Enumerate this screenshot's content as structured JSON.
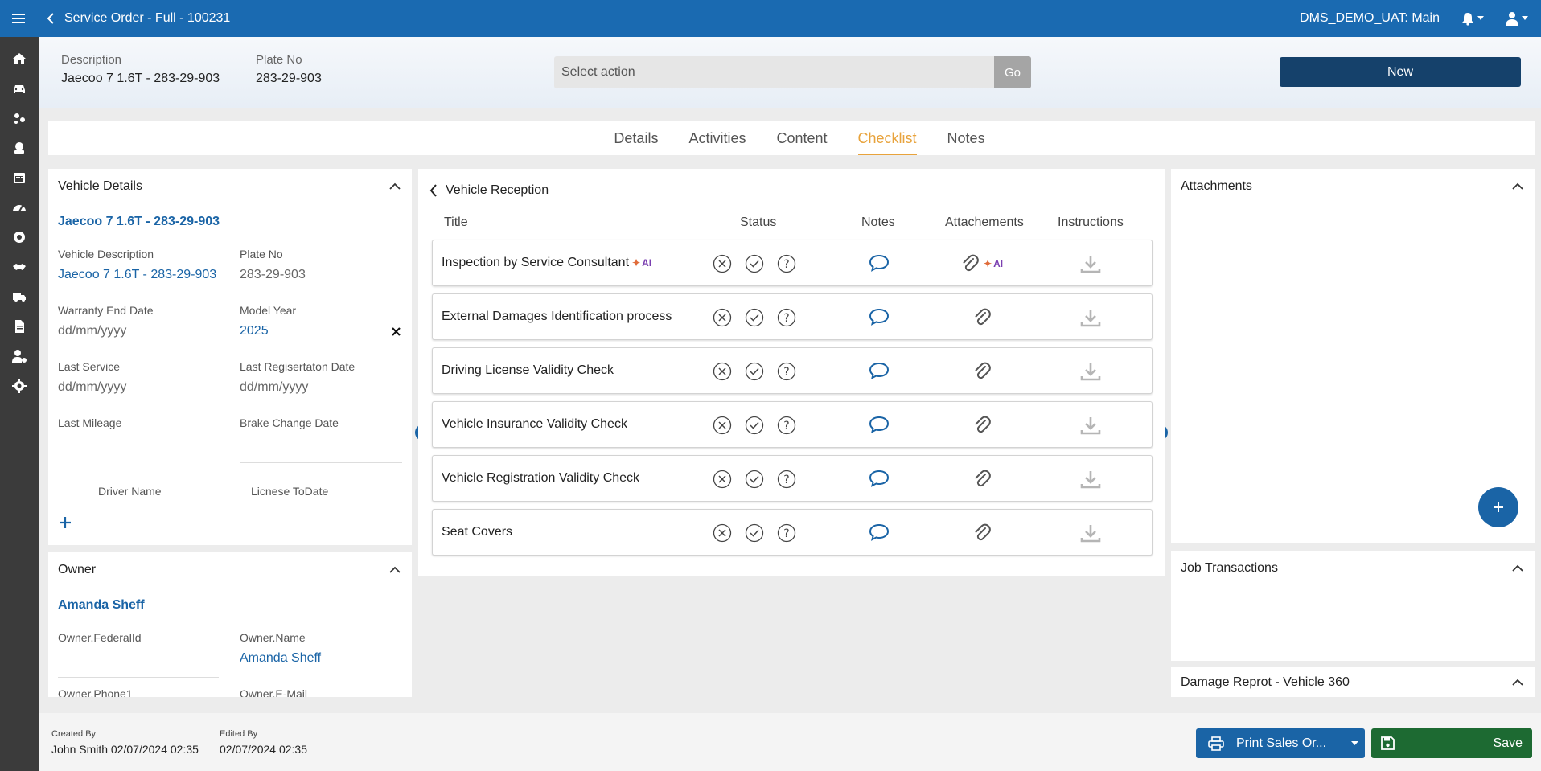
{
  "topbar": {
    "title": "Service Order - Full - 100231",
    "environment": "DMS_DEMO_UAT: Main"
  },
  "header": {
    "description_label": "Description",
    "description_value": "Jaecoo 7 1.6T - 283-29-903",
    "plate_label": "Plate No",
    "plate_value": "283-29-903",
    "action_placeholder": "Select action",
    "go_label": "Go",
    "new_label": "New"
  },
  "tabs": [
    "Details",
    "Activities",
    "Content",
    "Checklist",
    "Notes"
  ],
  "active_tab": "Checklist",
  "vehicle_details": {
    "title": "Vehicle Details",
    "vehicle_link": "Jaecoo 7 1.6T - 283-29-903",
    "vehicle_description_label": "Vehicle Description",
    "vehicle_description_value": "Jaecoo 7 1.6T - 283-29-903",
    "plate_label": "Plate No",
    "plate_value": "283-29-903",
    "warranty_label": "Warranty End Date",
    "warranty_value": "dd/mm/yyyy",
    "model_year_label": "Model Year",
    "model_year_value": "2025",
    "last_service_label": "Last Service",
    "last_service_value": "dd/mm/yyyy",
    "last_registration_label": "Last Regisertaton Date",
    "last_registration_value": "dd/mm/yyyy",
    "last_mileage_label": "Last Mileage",
    "brake_change_label": "Brake Change Date",
    "driver_name_label": "Driver Name",
    "license_label": "Licnese ToDate"
  },
  "owner": {
    "title": "Owner",
    "owner_link": "Amanda Sheff",
    "federal_label": "Owner.FederalId",
    "name_label": "Owner.Name",
    "name_value": "Amanda Sheff",
    "phone_label": "Owner.Phone1",
    "email_label": "Owner.E-Mail"
  },
  "checklist": {
    "title": "Vehicle Reception",
    "columns": {
      "title": "Title",
      "status": "Status",
      "notes": "Notes",
      "attachments": "Attachements",
      "instructions": "Instructions"
    },
    "ai_label": "AI",
    "rows": [
      {
        "title": "Inspection by Service Consultant",
        "ai": true
      },
      {
        "title": "External Damages Identification process",
        "ai": false
      },
      {
        "title": "Driving License Validity Check",
        "ai": false
      },
      {
        "title": "Vehicle Insurance Validity Check",
        "ai": false
      },
      {
        "title": "Vehicle Registration Validity Check",
        "ai": false
      },
      {
        "title": "Seat Covers",
        "ai": false
      }
    ]
  },
  "attachments": {
    "title": "Attachments"
  },
  "job_transactions": {
    "title": "Job Transactions"
  },
  "damage_report": {
    "title": "Damage Reprot - Vehicle 360"
  },
  "footer": {
    "created_label": "Created By",
    "created_value": "John Smith 02/07/2024 02:35",
    "edited_label": "Edited By",
    "edited_value": "02/07/2024 02:35",
    "print_label": "Print Sales Or...",
    "save_label": "Save"
  },
  "colors": {
    "topbar": "#1a6ab1",
    "rail": "#3b3b3b",
    "accent_tab": "#e8a33c",
    "link": "#1a64a6",
    "new_button": "#15416b",
    "save_button": "#1d6a32"
  }
}
